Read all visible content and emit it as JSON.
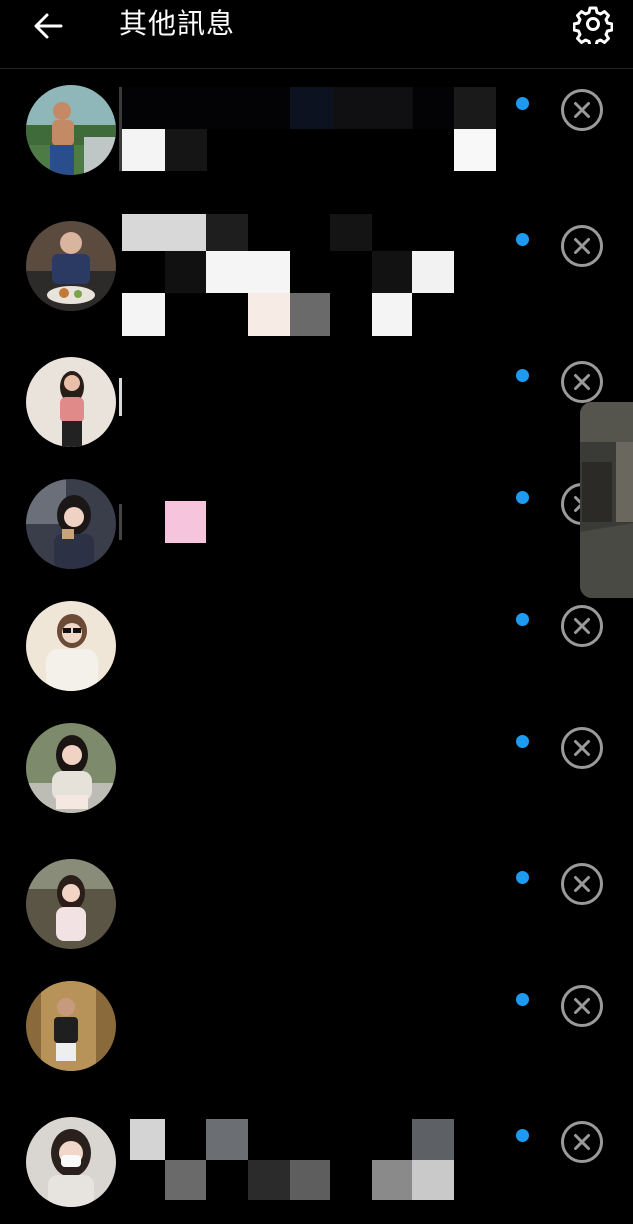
{
  "header": {
    "title": "其他訊息",
    "back_icon": "arrow-left-icon",
    "settings_icon": "gear-icon"
  },
  "theme": {
    "background": "#000000",
    "unread_dot": "#1d9bf0",
    "close_ring": "#9a9a9a"
  },
  "conversations": [
    {
      "id": 1,
      "unread": true
    },
    {
      "id": 2,
      "unread": true
    },
    {
      "id": 3,
      "unread": true
    },
    {
      "id": 4,
      "unread": true
    },
    {
      "id": 5,
      "unread": true
    },
    {
      "id": 6,
      "unread": true
    },
    {
      "id": 7,
      "unread": true
    },
    {
      "id": 8,
      "unread": true
    },
    {
      "id": 9,
      "unread": true
    }
  ]
}
